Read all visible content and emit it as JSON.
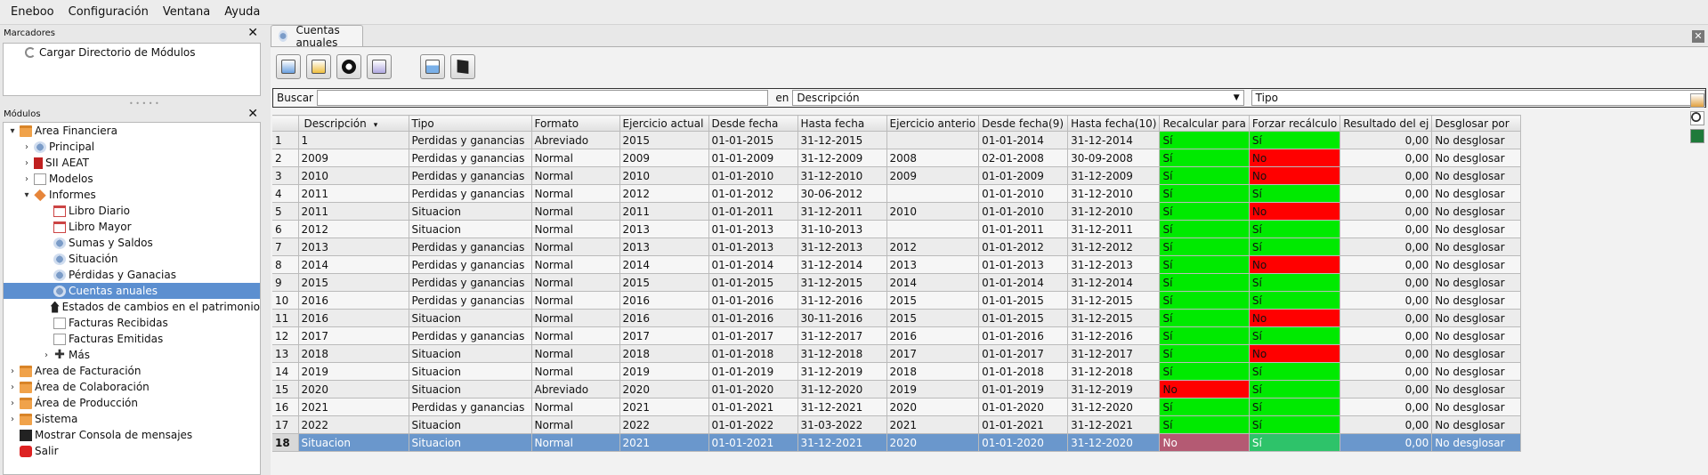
{
  "menu": [
    {
      "label": "Eneboo"
    },
    {
      "label": "Configuración"
    },
    {
      "label": "Ventana"
    },
    {
      "label": "Ayuda"
    }
  ],
  "bookmarks": {
    "title": "Marcadores",
    "items": [
      "Cargar Directorio de Módulos"
    ]
  },
  "modules": {
    "title": "Módulos",
    "tree": [
      {
        "label": "Area Financiera",
        "level": 0,
        "icon": "folder-icon",
        "toggle": "▾"
      },
      {
        "label": "Principal",
        "level": 1,
        "icon": "gear-icon",
        "toggle": "›"
      },
      {
        "label": "SII AEAT",
        "level": 1,
        "icon": "sii-icon",
        "toggle": "›"
      },
      {
        "label": "Modelos",
        "level": 1,
        "icon": "doc-icon",
        "toggle": "›"
      },
      {
        "label": "Informes",
        "level": 1,
        "icon": "tag-icon",
        "toggle": "▾"
      },
      {
        "label": "Libro Diario",
        "level": 2,
        "icon": "calendar-icon",
        "toggle": ""
      },
      {
        "label": "Libro Mayor",
        "level": 2,
        "icon": "calendar-icon",
        "toggle": ""
      },
      {
        "label": "Sumas y Saldos",
        "level": 2,
        "icon": "gear-icon",
        "toggle": ""
      },
      {
        "label": "Situación",
        "level": 2,
        "icon": "gear-icon",
        "toggle": ""
      },
      {
        "label": "Pérdidas y Ganacias",
        "level": 2,
        "icon": "gear-icon",
        "toggle": ""
      },
      {
        "label": "Cuentas anuales",
        "level": 2,
        "icon": "gear-icon",
        "toggle": "",
        "selected": true
      },
      {
        "label": "Estados de cambios en el patrimonio",
        "level": 2,
        "icon": "house-icon",
        "toggle": ""
      },
      {
        "label": "Facturas Recibidas",
        "level": 2,
        "icon": "doc-icon",
        "toggle": ""
      },
      {
        "label": "Facturas Emitidas",
        "level": 2,
        "icon": "doc-icon",
        "toggle": ""
      },
      {
        "label": "Más",
        "level": 2,
        "icon": "plus-icon",
        "toggle": "›"
      },
      {
        "label": "Area de Facturación",
        "level": 0,
        "icon": "folder-icon",
        "toggle": "›"
      },
      {
        "label": "Área de Colaboración",
        "level": 0,
        "icon": "folder-icon",
        "toggle": "›"
      },
      {
        "label": "Área de Producción",
        "level": 0,
        "icon": "folder-icon",
        "toggle": "›"
      },
      {
        "label": "Sistema",
        "level": 0,
        "icon": "folder-icon",
        "toggle": "›"
      },
      {
        "label": "Mostrar Consola de mensajes",
        "level": 0,
        "icon": "terminal-icon",
        "toggle": ""
      },
      {
        "label": "Salir",
        "level": 0,
        "icon": "exit-icon",
        "toggle": ""
      }
    ]
  },
  "tab": {
    "label": "Cuentas anuales"
  },
  "search": {
    "label": "Buscar",
    "value": "",
    "in_label": "en",
    "field_selected": "Descripción",
    "type_selected": "Tipo"
  },
  "grid": {
    "columns": [
      "Descripción",
      "Tipo",
      "Formato",
      "Ejercicio actual",
      "Desde fecha",
      "Hasta fecha",
      "Ejercicio anterio",
      "Desde fecha(9)",
      "Hasta fecha(10)",
      "Recalcular para",
      "Forzar recálculo",
      "Resultado del ej",
      "Desglosar por"
    ],
    "rows": [
      [
        "1",
        "1",
        "Perdidas y ganancias",
        "Abreviado",
        "2015",
        "01-01-2015",
        "31-12-2015",
        "",
        "01-01-2014",
        "31-12-2014",
        "Sí",
        "Sí",
        "0,00",
        "No desglosar"
      ],
      [
        "2",
        "2009",
        "Perdidas y ganancias",
        "Normal",
        "2009",
        "01-01-2009",
        "31-12-2009",
        "2008",
        "02-01-2008",
        "30-09-2008",
        "Sí",
        "No",
        "0,00",
        "No desglosar"
      ],
      [
        "3",
        "2010",
        "Perdidas y ganancias",
        "Normal",
        "2010",
        "01-01-2010",
        "31-12-2010",
        "2009",
        "01-01-2009",
        "31-12-2009",
        "Sí",
        "No",
        "0,00",
        "No desglosar"
      ],
      [
        "4",
        "2011",
        "Perdidas y ganancias",
        "Normal",
        "2012",
        "01-01-2012",
        "30-06-2012",
        "",
        "01-01-2010",
        "31-12-2010",
        "Sí",
        "Sí",
        "0,00",
        "No desglosar"
      ],
      [
        "5",
        "2011",
        "Situacion",
        "Normal",
        "2011",
        "01-01-2011",
        "31-12-2011",
        "2010",
        "01-01-2010",
        "31-12-2010",
        "Sí",
        "No",
        "0,00",
        "No desglosar"
      ],
      [
        "6",
        "2012",
        "Situacion",
        "Normal",
        "2013",
        "01-01-2013",
        "31-10-2013",
        "",
        "01-01-2011",
        "31-12-2011",
        "Sí",
        "Sí",
        "0,00",
        "No desglosar"
      ],
      [
        "7",
        "2013",
        "Perdidas y ganancias",
        "Normal",
        "2013",
        "01-01-2013",
        "31-12-2013",
        "2012",
        "01-01-2012",
        "31-12-2012",
        "Sí",
        "Sí",
        "0,00",
        "No desglosar"
      ],
      [
        "8",
        "2014",
        "Perdidas y ganancias",
        "Normal",
        "2014",
        "01-01-2014",
        "31-12-2014",
        "2013",
        "01-01-2013",
        "31-12-2013",
        "Sí",
        "No",
        "0,00",
        "No desglosar"
      ],
      [
        "9",
        "2015",
        "Perdidas y ganancias",
        "Normal",
        "2015",
        "01-01-2015",
        "31-12-2015",
        "2014",
        "01-01-2014",
        "31-12-2014",
        "Sí",
        "Sí",
        "0,00",
        "No desglosar"
      ],
      [
        "10",
        "2016",
        "Perdidas y ganancias",
        "Normal",
        "2016",
        "01-01-2016",
        "31-12-2016",
        "2015",
        "01-01-2015",
        "31-12-2015",
        "Sí",
        "Sí",
        "0,00",
        "No desglosar"
      ],
      [
        "11",
        "2016",
        "Situacion",
        "Normal",
        "2016",
        "01-01-2016",
        "30-11-2016",
        "2015",
        "01-01-2015",
        "31-12-2015",
        "Sí",
        "No",
        "0,00",
        "No desglosar"
      ],
      [
        "12",
        "2017",
        "Perdidas y ganancias",
        "Normal",
        "2017",
        "01-01-2017",
        "31-12-2017",
        "2016",
        "01-01-2016",
        "31-12-2016",
        "Sí",
        "Sí",
        "0,00",
        "No desglosar"
      ],
      [
        "13",
        "2018",
        "Situacion",
        "Normal",
        "2018",
        "01-01-2018",
        "31-12-2018",
        "2017",
        "01-01-2017",
        "31-12-2017",
        "Sí",
        "No",
        "0,00",
        "No desglosar"
      ],
      [
        "14",
        "2019",
        "Situacion",
        "Normal",
        "2019",
        "01-01-2019",
        "31-12-2019",
        "2018",
        "01-01-2018",
        "31-12-2018",
        "Sí",
        "Sí",
        "0,00",
        "No desglosar"
      ],
      [
        "15",
        "2020",
        "Situacion",
        "Abreviado",
        "2020",
        "01-01-2020",
        "31-12-2020",
        "2019",
        "01-01-2019",
        "31-12-2019",
        "No",
        "Sí",
        "0,00",
        "No desglosar"
      ],
      [
        "16",
        "2021",
        "Perdidas y ganancias",
        "Normal",
        "2021",
        "01-01-2021",
        "31-12-2021",
        "2020",
        "01-01-2020",
        "31-12-2020",
        "Sí",
        "Sí",
        "0,00",
        "No desglosar"
      ],
      [
        "17",
        "2022",
        "Situacion",
        "Normal",
        "2022",
        "01-01-2022",
        "31-03-2022",
        "2021",
        "01-01-2021",
        "31-12-2021",
        "Sí",
        "Sí",
        "0,00",
        "No desglosar"
      ],
      [
        "18",
        "Situacion",
        "Situacion",
        "Normal",
        "2021",
        "01-01-2021",
        "31-12-2021",
        "2020",
        "01-01-2020",
        "31-12-2020",
        "No",
        "Sí",
        "0,00",
        "No desglosar"
      ]
    ],
    "selected_row": 17,
    "colors": {
      "yes": "#00ea00",
      "no": "#ff0000",
      "selection": "#6a97cc"
    }
  }
}
